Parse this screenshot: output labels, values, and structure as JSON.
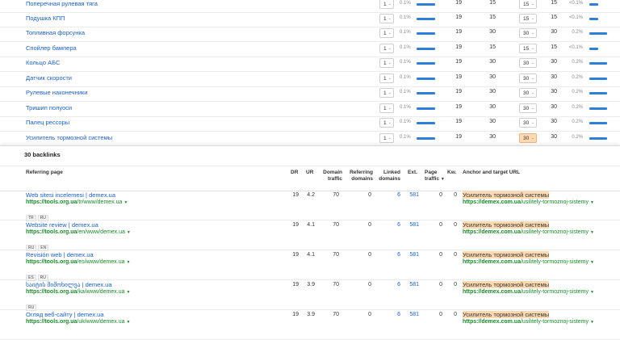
{
  "keywords": [
    {
      "name": "Поперечная рулевая тяга",
      "pos": "1",
      "pct": "0.1%",
      "bar": 0.9,
      "v1": "19",
      "v2": "15",
      "pos2": "15",
      "v3": "15",
      "pct2": "<0.1%",
      "bar2": 0.45,
      "hl": false
    },
    {
      "name": "Подушка КПП",
      "pos": "1",
      "pct": "0.1%",
      "bar": 0.9,
      "v1": "19",
      "v2": "15",
      "pos2": "15",
      "v3": "15",
      "pct2": "<0.1%",
      "bar2": 0.45,
      "hl": false
    },
    {
      "name": "Топливная форсунка",
      "pos": "1",
      "pct": "0.1%",
      "bar": 0.9,
      "v1": "19",
      "v2": "30",
      "pos2": "30",
      "v3": "30",
      "pct2": "0.2%",
      "bar2": 0.9,
      "hl": false
    },
    {
      "name": "Спойлер бампера",
      "pos": "1",
      "pct": "0.1%",
      "bar": 0.9,
      "v1": "19",
      "v2": "15",
      "pos2": "15",
      "v3": "15",
      "pct2": "<0.1%",
      "bar2": 0.45,
      "hl": false
    },
    {
      "name": "Кольцо АБС",
      "pos": "1",
      "pct": "0.1%",
      "bar": 0.9,
      "v1": "19",
      "v2": "30",
      "pos2": "30",
      "v3": "30",
      "pct2": "0.2%",
      "bar2": 0.9,
      "hl": false
    },
    {
      "name": "Датчик скорости",
      "pos": "1",
      "pct": "0.1%",
      "bar": 0.9,
      "v1": "19",
      "v2": "30",
      "pos2": "30",
      "v3": "30",
      "pct2": "0.2%",
      "bar2": 0.9,
      "hl": false
    },
    {
      "name": "Рулевые наконечники",
      "pos": "1",
      "pct": "0.1%",
      "bar": 0.9,
      "v1": "19",
      "v2": "30",
      "pos2": "30",
      "v3": "30",
      "pct2": "0.2%",
      "bar2": 0.9,
      "hl": false
    },
    {
      "name": "Тришип полуоси",
      "pos": "1",
      "pct": "0.1%",
      "bar": 0.9,
      "v1": "19",
      "v2": "30",
      "pos2": "30",
      "v3": "30",
      "pct2": "0.2%",
      "bar2": 0.9,
      "hl": false
    },
    {
      "name": "Палец рессоры",
      "pos": "1",
      "pct": "0.1%",
      "bar": 0.9,
      "v1": "19",
      "v2": "30",
      "pos2": "30",
      "v3": "30",
      "pct2": "0.2%",
      "bar2": 0.9,
      "hl": false
    },
    {
      "name": "Усилитель тормозной системы",
      "pos": "1",
      "pct": "0.1%",
      "bar": 0.9,
      "v1": "19",
      "v2": "30",
      "pos2": "30",
      "v3": "30",
      "pct2": "0.2%",
      "bar2": 0.9,
      "hl": true
    }
  ],
  "backlinks": {
    "title": "30 backlinks",
    "headers": {
      "referring_page": "Referring page",
      "dr": "DR",
      "ur": "UR",
      "domain_traffic": "Domain traffic",
      "referring_domains": "Referring domains",
      "linked_domains": "Linked domains",
      "ext": "Ext.",
      "page_traffic": "Page traffic",
      "kw": "Kw.",
      "anchor": "Anchor and target URL"
    },
    "rows": [
      {
        "title": "Web sitesi incelemesi | demex.ua",
        "url_host": "https://tools.org.ua",
        "url_path": "/tr/www/demex.ua",
        "tags": [
          "TR",
          "RU"
        ],
        "dr": "19",
        "ur": "4.2",
        "traffic": "70",
        "ref_domains": "0",
        "linked": "6",
        "ext": "581",
        "page_traffic": "0",
        "kw": "0",
        "anchor": "Усилитель тормозной системы",
        "target_host": "https://demex.com.ua",
        "target_path": "/usilitely-tormoznoj-sistemy"
      },
      {
        "title": "Website review | demex.ua",
        "url_host": "https://tools.org.ua",
        "url_path": "/en/www/demex.ua",
        "tags": [
          "RU",
          "EN"
        ],
        "dr": "19",
        "ur": "4.1",
        "traffic": "70",
        "ref_domains": "0",
        "linked": "6",
        "ext": "581",
        "page_traffic": "0",
        "kw": "0",
        "anchor": "Усилитель тормозной системы",
        "target_host": "https://demex.com.ua",
        "target_path": "/usilitely-tormoznoj-sistemy"
      },
      {
        "title": "Revisión web | demex.ua",
        "url_host": "https://tools.org.ua",
        "url_path": "/es/www/demex.ua",
        "tags": [
          "ES",
          "RU"
        ],
        "dr": "19",
        "ur": "4.1",
        "traffic": "70",
        "ref_domains": "0",
        "linked": "6",
        "ext": "581",
        "page_traffic": "0",
        "kw": "0",
        "anchor": "Усилитель тормозной системы",
        "target_host": "https://demex.com.ua",
        "target_path": "/usilitely-tormoznoj-sistemy"
      },
      {
        "title": "საიტის მიმოხილვა | demex.ua",
        "url_host": "https://tools.org.ua",
        "url_path": "/ka/www/demex.ua",
        "tags": [
          "RU"
        ],
        "dr": "19",
        "ur": "3.9",
        "traffic": "70",
        "ref_domains": "0",
        "linked": "6",
        "ext": "581",
        "page_traffic": "0",
        "kw": "0",
        "anchor": "Усилитель тормозной системы",
        "target_host": "https://demex.com.ua",
        "target_path": "/usilitely-tormoznoj-sistemy"
      },
      {
        "title": "Огляд веб-сайту | demex.ua",
        "url_host": "https://tools.org.ua",
        "url_path": "/uk/www/demex.ua",
        "tags": [],
        "dr": "19",
        "ur": "3.9",
        "traffic": "70",
        "ref_domains": "0",
        "linked": "6",
        "ext": "581",
        "page_traffic": "0",
        "kw": "0",
        "anchor": "Усилитель тормозной системы",
        "target_host": "https://demex.com.ua",
        "target_path": "/usilitely-tormoznoj-sistemy"
      }
    ]
  },
  "colors": {
    "link": "#1a5fc8",
    "url": "#1a8a2a",
    "highlight": "#ffd9b0",
    "bar": "#2f7ed8"
  }
}
